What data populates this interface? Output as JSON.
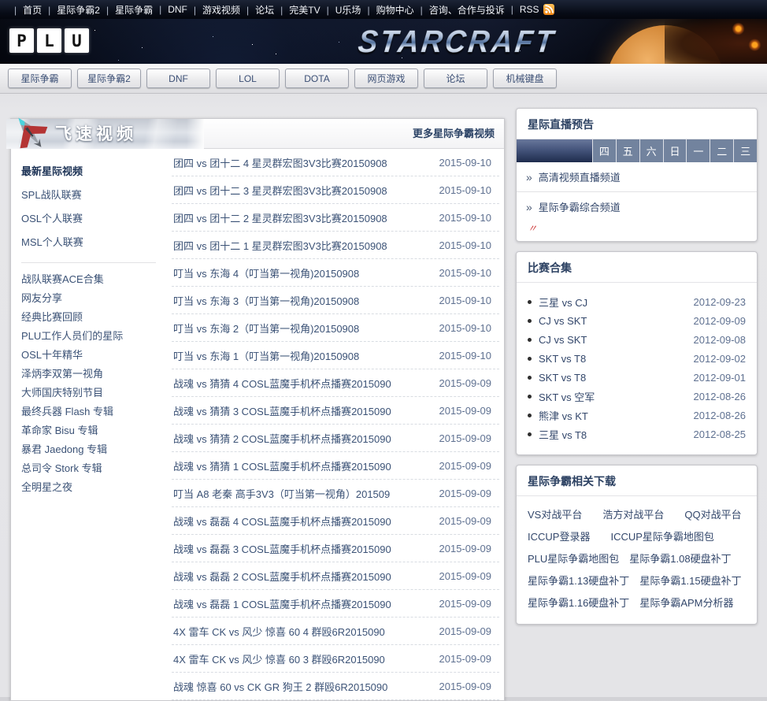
{
  "topbar": {
    "links": [
      "首页",
      "星际争霸2",
      "星际争霸",
      "DNF",
      "游戏视频",
      "论坛",
      "完美TV",
      "U乐场",
      "购物中心",
      "咨询、合作与投诉"
    ],
    "rss_label": "RSS",
    "rss_icon": "rss-icon"
  },
  "header": {
    "logo_letters": [
      "P",
      "L",
      "U"
    ],
    "banner_title": "STARCRAFT"
  },
  "nav": {
    "items": [
      "星际争霸",
      "星际争霸2",
      "DNF",
      "LOL",
      "DOTA",
      "网页游戏",
      "论坛",
      "机械键盘"
    ]
  },
  "video_panel": {
    "banner_title": "飞速视频",
    "banner_icon": "spaceship-icon",
    "more_link": "更多星际争霸视频",
    "sidebar_group1": [
      "最新星际视频",
      "SPL战队联赛",
      "OSL个人联赛",
      "MSL个人联赛"
    ],
    "sidebar_group2": [
      "战队联赛ACE合集",
      "网友分享",
      "经典比赛回顾",
      "PLU工作人员们的星际",
      "OSL十年精华",
      "泽炳李双第一视角",
      "大师国庆特别节目",
      "最终兵器 Flash 专辑",
      "革命家 Bisu 专辑",
      "暴君 Jaedong 专辑",
      "总司令 Stork 专辑",
      "全明星之夜"
    ],
    "videos": [
      {
        "title": "团四 vs 团十二 4 星灵群宏图3V3比赛20150908",
        "date": "2015-09-10"
      },
      {
        "title": "团四 vs 团十二 3 星灵群宏图3V3比赛20150908",
        "date": "2015-09-10"
      },
      {
        "title": "团四 vs 团十二 2 星灵群宏图3V3比赛20150908",
        "date": "2015-09-10"
      },
      {
        "title": "团四 vs 团十二 1 星灵群宏图3V3比赛20150908",
        "date": "2015-09-10"
      },
      {
        "title": "叮当 vs 东海 4（叮当第一视角)20150908",
        "date": "2015-09-10"
      },
      {
        "title": "叮当 vs 东海 3（叮当第一视角)20150908",
        "date": "2015-09-10"
      },
      {
        "title": "叮当 vs 东海 2（叮当第一视角)20150908",
        "date": "2015-09-10"
      },
      {
        "title": "叮当 vs 东海 1（叮当第一视角)20150908",
        "date": "2015-09-10"
      },
      {
        "title": "战魂 vs 猜猜 4 COSL蓝魔手机杯点播赛2015090",
        "date": "2015-09-09"
      },
      {
        "title": "战魂 vs 猜猜 3 COSL蓝魔手机杯点播赛2015090",
        "date": "2015-09-09"
      },
      {
        "title": "战魂 vs 猜猜 2 COSL蓝魔手机杯点播赛2015090",
        "date": "2015-09-09"
      },
      {
        "title": "战魂 vs 猜猜 1 COSL蓝魔手机杯点播赛2015090",
        "date": "2015-09-09"
      },
      {
        "title": "叮当 A8 老秦 高手3V3（叮当第一视角）201509",
        "date": "2015-09-09"
      },
      {
        "title": "战魂 vs 磊磊 4 COSL蓝魔手机杯点播赛2015090",
        "date": "2015-09-09"
      },
      {
        "title": "战魂 vs 磊磊 3 COSL蓝魔手机杯点播赛2015090",
        "date": "2015-09-09"
      },
      {
        "title": "战魂 vs 磊磊 2 COSL蓝魔手机杯点播赛2015090",
        "date": "2015-09-09"
      },
      {
        "title": "战魂 vs 磊磊 1 COSL蓝魔手机杯点播赛2015090",
        "date": "2015-09-09"
      },
      {
        "title": "4X 雷车 CK vs 风少 惊喜 60 4 群殴6R2015090",
        "date": "2015-09-09"
      },
      {
        "title": "4X 雷车 CK vs 风少 惊喜 60 3 群殴6R2015090",
        "date": "2015-09-09"
      },
      {
        "title": "战魂 惊喜 60 vs CK GR 狗王 2 群殴6R2015090",
        "date": "2015-09-09"
      }
    ]
  },
  "live_box": {
    "title": "星际直播预告",
    "weekdays": [
      "四",
      "五",
      "六",
      "日",
      "一",
      "二",
      "三"
    ],
    "arrow": "»",
    "channels": [
      "高清视频直播频道",
      "星际争霸综合频道"
    ],
    "red_mark": "〃"
  },
  "matches_box": {
    "title": "比赛合集",
    "items": [
      {
        "name": "三星 vs CJ",
        "date": "2012-09-23"
      },
      {
        "name": "CJ vs SKT",
        "date": "2012-09-09"
      },
      {
        "name": "CJ vs SKT",
        "date": "2012-09-08"
      },
      {
        "name": "SKT vs T8",
        "date": "2012-09-02"
      },
      {
        "name": "SKT vs T8",
        "date": "2012-09-01"
      },
      {
        "name": "SKT vs 空军",
        "date": "2012-08-26"
      },
      {
        "name": "熊津 vs KT",
        "date": "2012-08-26"
      },
      {
        "name": "三星 vs T8",
        "date": "2012-08-25"
      }
    ]
  },
  "downloads_box": {
    "title": "星际争霸相关下载",
    "rows": [
      [
        "VS对战平台",
        "浩方对战平台",
        "QQ对战平台"
      ],
      [
        "ICCUP登录器",
        "ICCUP星际争霸地图包"
      ],
      [
        "PLU星际争霸地图包",
        "星际争霸1.08硬盘补丁"
      ],
      [
        "星际争霸1.13硬盘补丁",
        "星际争霸1.15硬盘补丁"
      ],
      [
        "星际争霸1.16硬盘补丁",
        "星际争霸APM分析器"
      ]
    ]
  },
  "colors": {
    "topbar_bg": "#0a0f1c",
    "link_text": "#33476b",
    "date_text": "#5f7191",
    "weekday_bg": "#72839e",
    "rss_orange": "#ef8210",
    "red_mark": "#cc3333"
  }
}
